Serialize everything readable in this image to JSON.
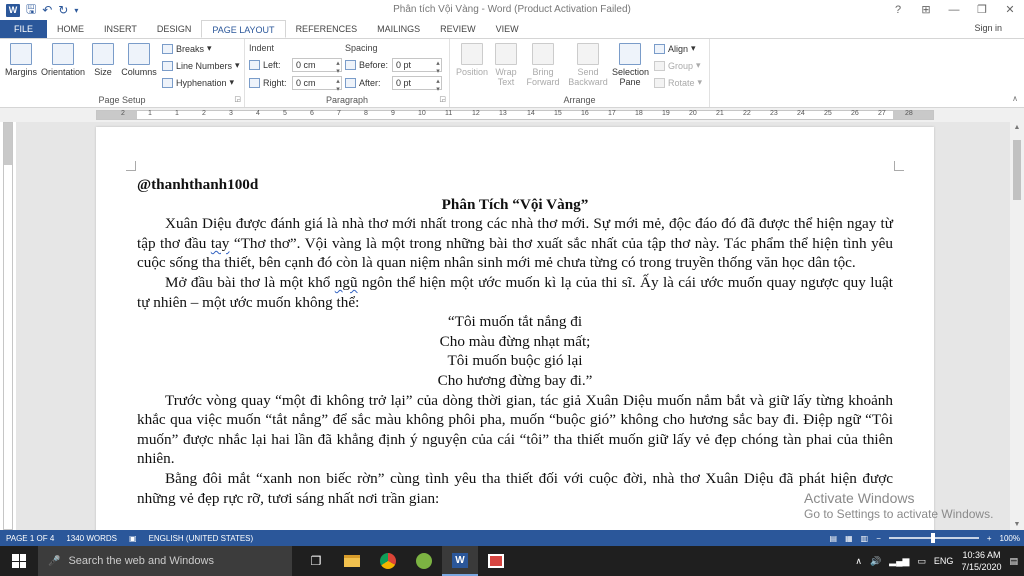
{
  "window": {
    "title": "Phân tích Vội Vàng - Word (Product Activation Failed)",
    "controls": [
      "?",
      "⊞",
      "—",
      "❐",
      "✕"
    ]
  },
  "tabs": [
    "FILE",
    "HOME",
    "INSERT",
    "DESIGN",
    "PAGE LAYOUT",
    "REFERENCES",
    "MAILINGS",
    "REVIEW",
    "VIEW"
  ],
  "signin": "Sign in",
  "ribbon": {
    "page_setup": {
      "label": "Page Setup",
      "margins": "Margins",
      "orientation": "Orientation",
      "size": "Size",
      "columns": "Columns",
      "breaks": "Breaks",
      "line_numbers": "Line Numbers",
      "hyphenation": "Hyphenation"
    },
    "paragraph": {
      "label": "Paragraph",
      "indent": "Indent",
      "spacing": "Spacing",
      "left_label": "Left:",
      "left_value": "0 cm",
      "right_label": "Right:",
      "right_value": "0 cm",
      "before_label": "Before:",
      "before_value": "0 pt",
      "after_label": "After:",
      "after_value": "0 pt"
    },
    "arrange": {
      "label": "Arrange",
      "position": "Position",
      "wrap_text": "Wrap Text",
      "bring_forward": "Bring Forward",
      "send_backward": "Send Backward",
      "selection_pane": "Selection Pane",
      "align": "Align",
      "group": "Group",
      "rotate": "Rotate"
    }
  },
  "ruler_numbers": [
    "2",
    "1",
    "1",
    "2",
    "3",
    "4",
    "5",
    "6",
    "7",
    "8",
    "9",
    "10",
    "11",
    "12",
    "13",
    "14",
    "15",
    "16",
    "17",
    "18",
    "19",
    "20",
    "21",
    "22",
    "23",
    "24",
    "25",
    "26",
    "27",
    "28"
  ],
  "document": {
    "handle": "@thanhthanh100d",
    "title": "Phân Tích “Vội Vàng”",
    "p1_a": "Xuân Diệu được đánh giá là nhà thơ mới nhất trong các nhà thơ mới. Sự mới mẻ, độc đáo đó đã được thể hiện ngay từ tập thơ đầu ",
    "p1_ul": "tay",
    "p1_b": " “Thơ thơ”. Vội vàng là một trong những bài thơ xuất sắc nhất của tập thơ này. Tác phẩm thể hiện tình yêu cuộc sống tha thiết, bên cạnh đó còn là quan niệm nhân sinh mới mẻ chưa từng có trong truyền thống văn học dân tộc.",
    "p2_a": "Mở đầu bài thơ là một khổ ",
    "p2_ul": "ngũ",
    "p2_b": " ngôn thể hiện một ước muốn kì lạ của thi sĩ. Ấy là cái ước muốn quay ngược quy luật tự nhiên – một ước muốn không thể:",
    "verse": [
      "“Tôi muốn tắt nắng đi",
      "Cho màu đừng nhạt mất;",
      "Tôi muốn buộc gió lại",
      "Cho hương đừng bay đi.”"
    ],
    "p3": "Trước vòng quay “một đi không trở lại” của dòng thời gian, tác giả Xuân Diệu muốn nắm bắt và giữ lấy từng khoảnh khắc qua việc muốn “tắt nắng” để sắc màu không phôi pha, muốn “buộc gió” không cho hương sắc bay đi. Điệp ngữ “Tôi muốn” được nhắc lại hai lần đã khẳng định ý nguyện của cái “tôi” tha thiết muốn giữ lấy vẻ đẹp chóng tàn phai của thiên nhiên.",
    "p4": "Bằng đôi mắt “xanh non biếc rờn” cùng tình yêu tha thiết đối với cuộc đời, nhà thơ Xuân Diệu đã phát hiện được những vẻ đẹp rực rỡ, tươi sáng nhất nơi trần gian:"
  },
  "watermark": {
    "line1": "Activate Windows",
    "line2": "Go to Settings to activate Windows."
  },
  "status": {
    "page": "PAGE 1 OF 4",
    "words": "1340 WORDS",
    "language": "ENGLISH (UNITED STATES)",
    "zoom": "100%"
  },
  "taskbar": {
    "search_placeholder": "Search the web and Windows",
    "language": "ENG",
    "time": "10:36 AM",
    "date": "7/15/2020"
  },
  "colors": {
    "word_blue": "#2b579a",
    "taskbar": "#1f1f1f"
  }
}
